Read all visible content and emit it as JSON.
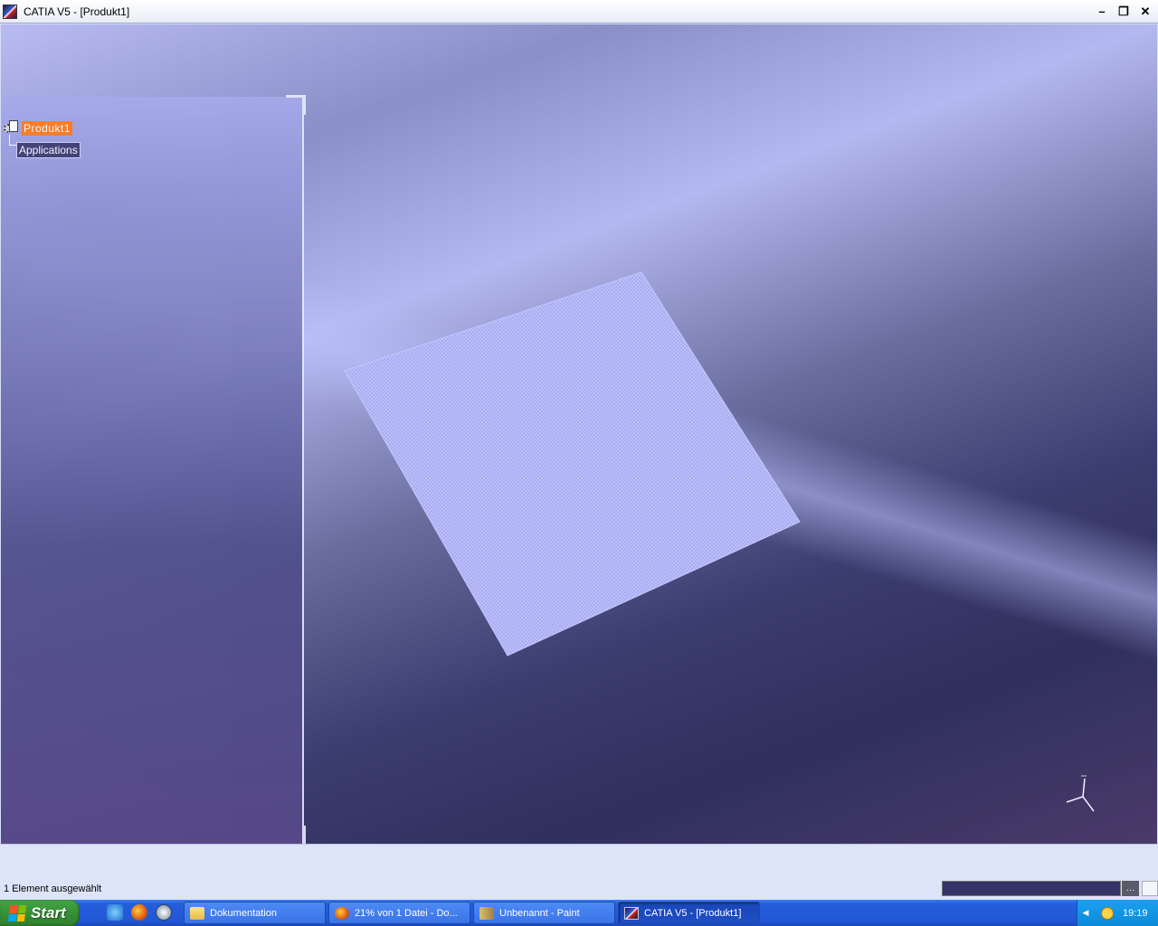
{
  "window": {
    "title": "CATIA V5 - [Produkt1]",
    "minimize": "–",
    "restore": "❐",
    "close": "✕"
  },
  "tree": {
    "root_label": "Produkt1",
    "child_label": "Applications"
  },
  "status": {
    "text": "1 Element ausgewählt",
    "cmd_button": "…"
  },
  "taskbar": {
    "start_label": "Start",
    "tasks": [
      {
        "label": "Dokumentation",
        "icon": "folder-icon"
      },
      {
        "label": "21% von 1 Datei - Do...",
        "icon": "firefox-icon"
      },
      {
        "label": "Unbenannt - Paint",
        "icon": "paint-icon"
      },
      {
        "label": "CATIA V5 - [Produkt1]",
        "icon": "catia-icon"
      }
    ],
    "clock": "19:19"
  },
  "colors": {
    "selection_orange": "#ff7a1a",
    "taskbar_blue": "#245edb",
    "start_green": "#3a943a"
  }
}
